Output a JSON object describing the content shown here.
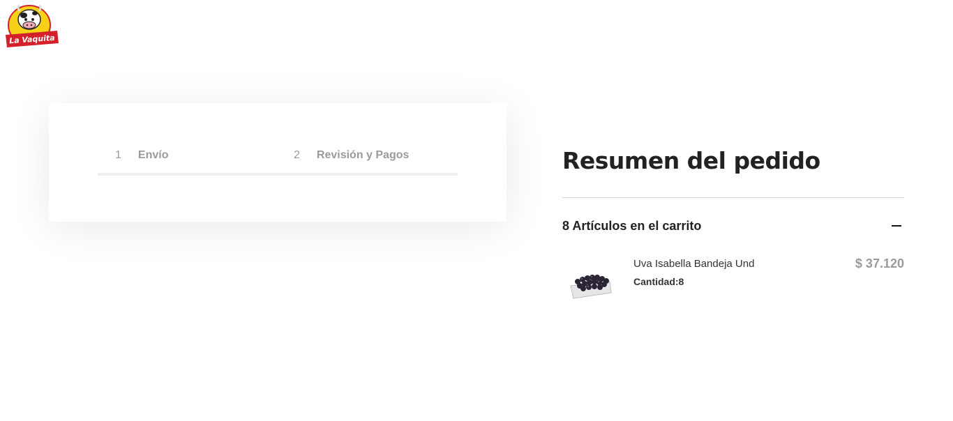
{
  "brand": {
    "logo_text": "La Vaquita",
    "logo_icon": "cow-logo-icon"
  },
  "checkout_steps": [
    {
      "number": "1",
      "label": "Envío"
    },
    {
      "number": "2",
      "label": "Revisión y Pagos"
    }
  ],
  "summary": {
    "title": "Resumen del pedido",
    "cart_count_label": "8 Artículos en el carrito",
    "collapse_icon": "minus-icon",
    "items": [
      {
        "name": "Uva Isabella Bandeja Und",
        "quantity_label": "Cantidad:8",
        "price": "$ 37.120",
        "image_icon": "grapes-tray-image"
      }
    ]
  },
  "colors": {
    "brand_red": "#d4202a",
    "brand_yellow": "#f7d117",
    "muted_text": "#9a9a9a",
    "dark_text": "#222222"
  }
}
